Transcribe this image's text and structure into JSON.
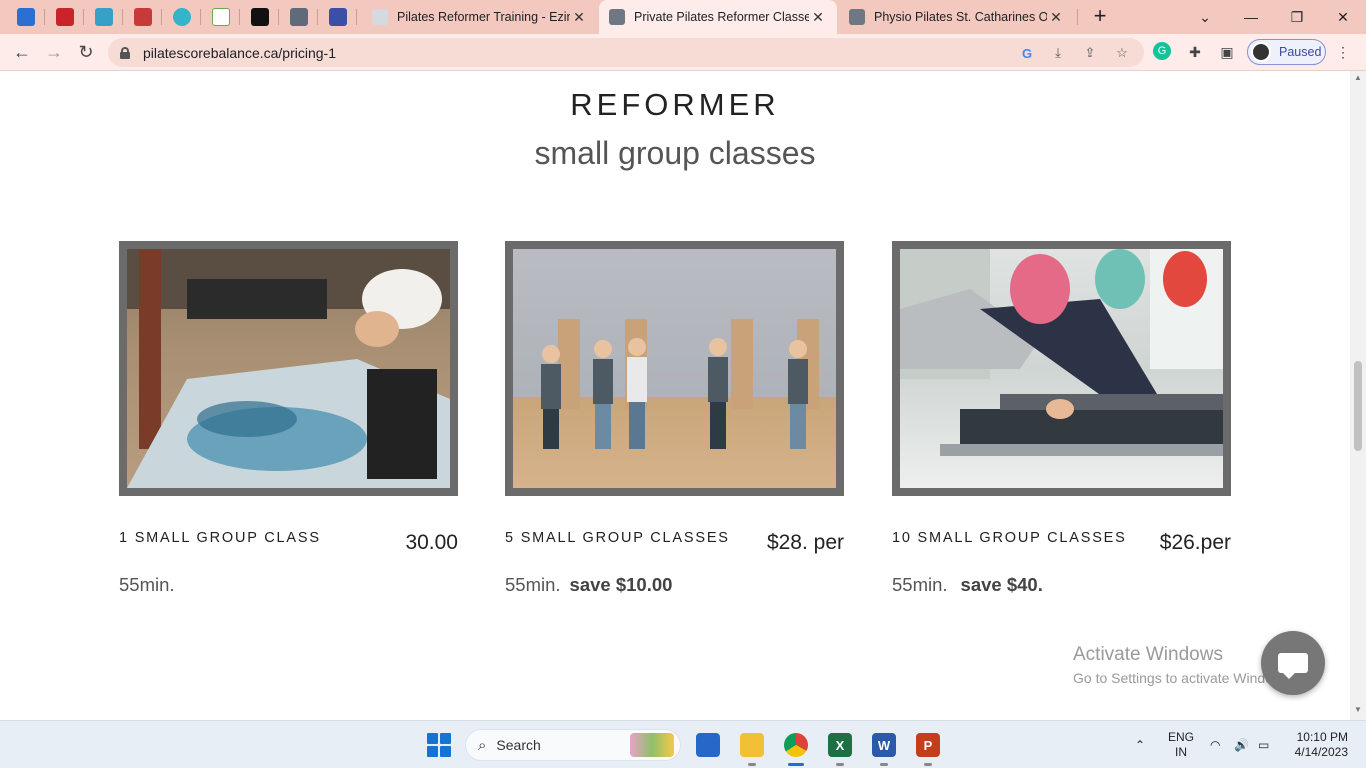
{
  "browser": {
    "tabs": [
      {
        "title": "Pilates Reformer Training - Ezine/",
        "favicon_color": "#d5d9e0"
      },
      {
        "title": "Private Pilates Reformer Classes |",
        "favicon_color": "#6f7782"
      },
      {
        "title": "Physio Pilates St. Catharines Onta",
        "favicon_color": "#6f7782"
      }
    ],
    "pinned_tabs": [
      {
        "icon": "blue-swirl-icon",
        "color": "#2a6fd1"
      },
      {
        "icon": "red-figure-icon",
        "color": "#c8242a"
      },
      {
        "icon": "bow-icon",
        "color": "#37a0c8"
      },
      {
        "icon": "us-flag-icon",
        "color": "#c73a3a"
      },
      {
        "icon": "teal-drop-icon",
        "color": "#34b3c9"
      },
      {
        "icon": "green-i-icon",
        "color": "#6aa84f"
      },
      {
        "icon": "black-square-icon",
        "color": "#111111"
      },
      {
        "icon": "grey-logo-icon",
        "color": "#5f6b7a"
      },
      {
        "icon": "shield-logo-icon",
        "color": "#3b4fa6"
      }
    ],
    "url": "pilatescorebalance.ca/pricing-1",
    "profile_label": "Paused"
  },
  "page": {
    "title": "REFORMER",
    "subtitle": "small group classes",
    "cards": [
      {
        "name": "1 SMALL GROUP CLASS",
        "price": "30.00",
        "duration": "55min.",
        "save": ""
      },
      {
        "name": "5 SMALL GROUP CLASSES",
        "price": "$28. per",
        "duration": "55min.",
        "save": "save $10.00"
      },
      {
        "name": "10 SMALL GROUP CLASSES",
        "price": "$26.per",
        "duration": "55min.",
        "save": "save $40."
      }
    ]
  },
  "watermark": {
    "line1": "Activate Windows",
    "line2": "Go to Settings to activate Windows."
  },
  "taskbar": {
    "search_label": "Search",
    "lang_line1": "ENG",
    "lang_line2": "IN",
    "time": "10:10 PM",
    "date": "4/14/2023"
  }
}
